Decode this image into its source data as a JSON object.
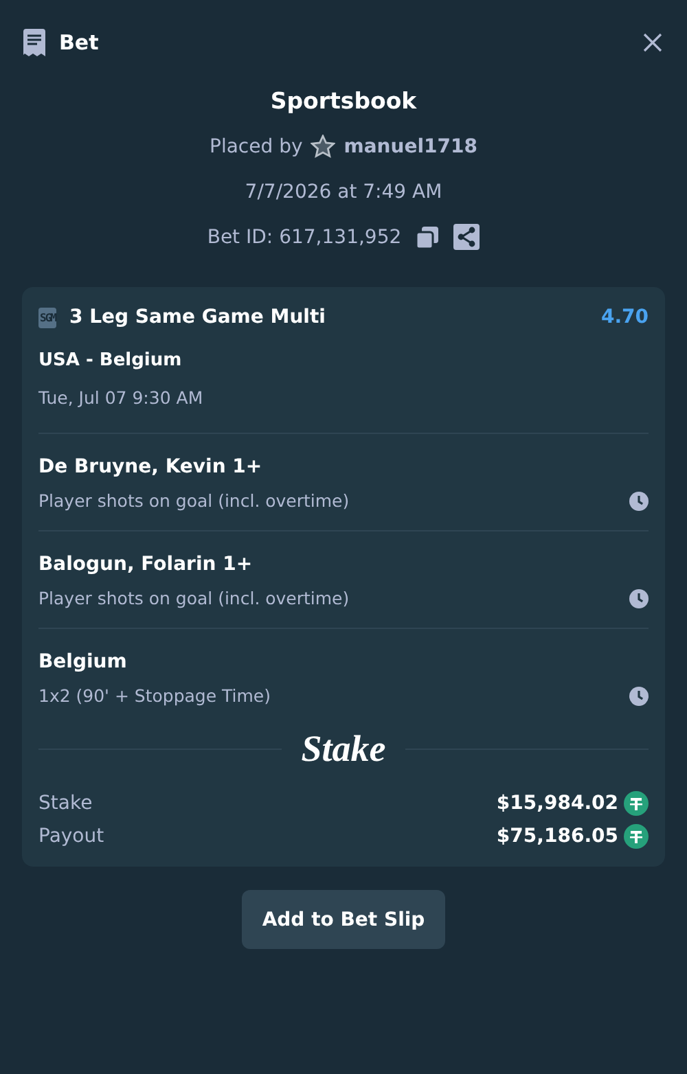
{
  "header": {
    "title": "Bet"
  },
  "summary": {
    "source": "Sportsbook",
    "placed_by_label": "Placed by",
    "username": "manuel1718",
    "placed_at": "7/7/2026 at 7:49 AM",
    "bet_id": "Bet ID: 617,131,952"
  },
  "bet": {
    "badge": "SGM",
    "title": "3 Leg Same Game Multi",
    "odds": "4.70",
    "match": "USA - Belgium",
    "match_time": "Tue, Jul 07 9:30 AM",
    "legs": [
      {
        "selection": "De Bruyne, Kevin 1+",
        "market": "Player shots on goal (incl. overtime)"
      },
      {
        "selection": "Balogun, Folarin 1+",
        "market": "Player shots on goal (incl. overtime)"
      },
      {
        "selection": "Belgium",
        "market": "1x2 (90' + Stoppage Time)"
      }
    ],
    "brand": "Stake",
    "totals": [
      {
        "label": "Stake",
        "amount": "$15,984.02"
      },
      {
        "label": "Payout",
        "amount": "$75,186.05"
      }
    ]
  },
  "button": "Add to Bet Slip"
}
